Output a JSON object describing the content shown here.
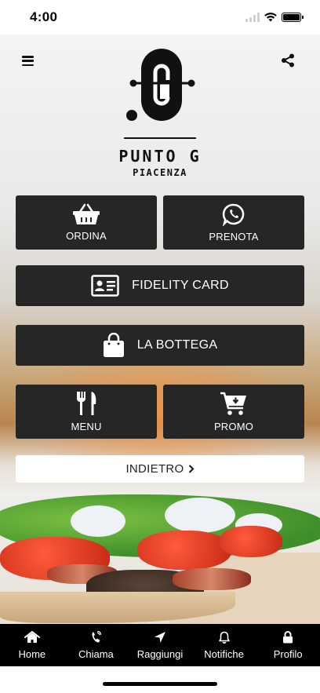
{
  "status_bar": {
    "time": "4:00"
  },
  "header": {
    "logo": {
      "name": "PUNTO G",
      "city": "PIACENZA"
    }
  },
  "tiles": {
    "ordina": {
      "label": "ORDINA",
      "icon": "basket-icon"
    },
    "prenota": {
      "label": "PRENOTA",
      "icon": "whatsapp-icon"
    },
    "fidelity": {
      "label": "FIDELITY CARD",
      "icon": "id-card-icon"
    },
    "bottega": {
      "label": "LA BOTTEGA",
      "icon": "shopping-bag-icon"
    },
    "menu": {
      "label": "MENU",
      "icon": "fork-knife-icon"
    },
    "promo": {
      "label": "PROMO",
      "icon": "cart-download-icon"
    }
  },
  "back_button": {
    "label": "INDIETRO"
  },
  "tab_bar": {
    "items": [
      {
        "label": "Home",
        "icon": "home-icon"
      },
      {
        "label": "Chiama",
        "icon": "phone-icon"
      },
      {
        "label": "Raggiungi",
        "icon": "location-arrow-icon"
      },
      {
        "label": "Notifiche",
        "icon": "bell-icon"
      },
      {
        "label": "Profilo",
        "icon": "lock-icon"
      }
    ]
  },
  "colors": {
    "tile_background": "#262626",
    "tab_bar_background": "#000000",
    "accent_text": "#ffffff"
  }
}
